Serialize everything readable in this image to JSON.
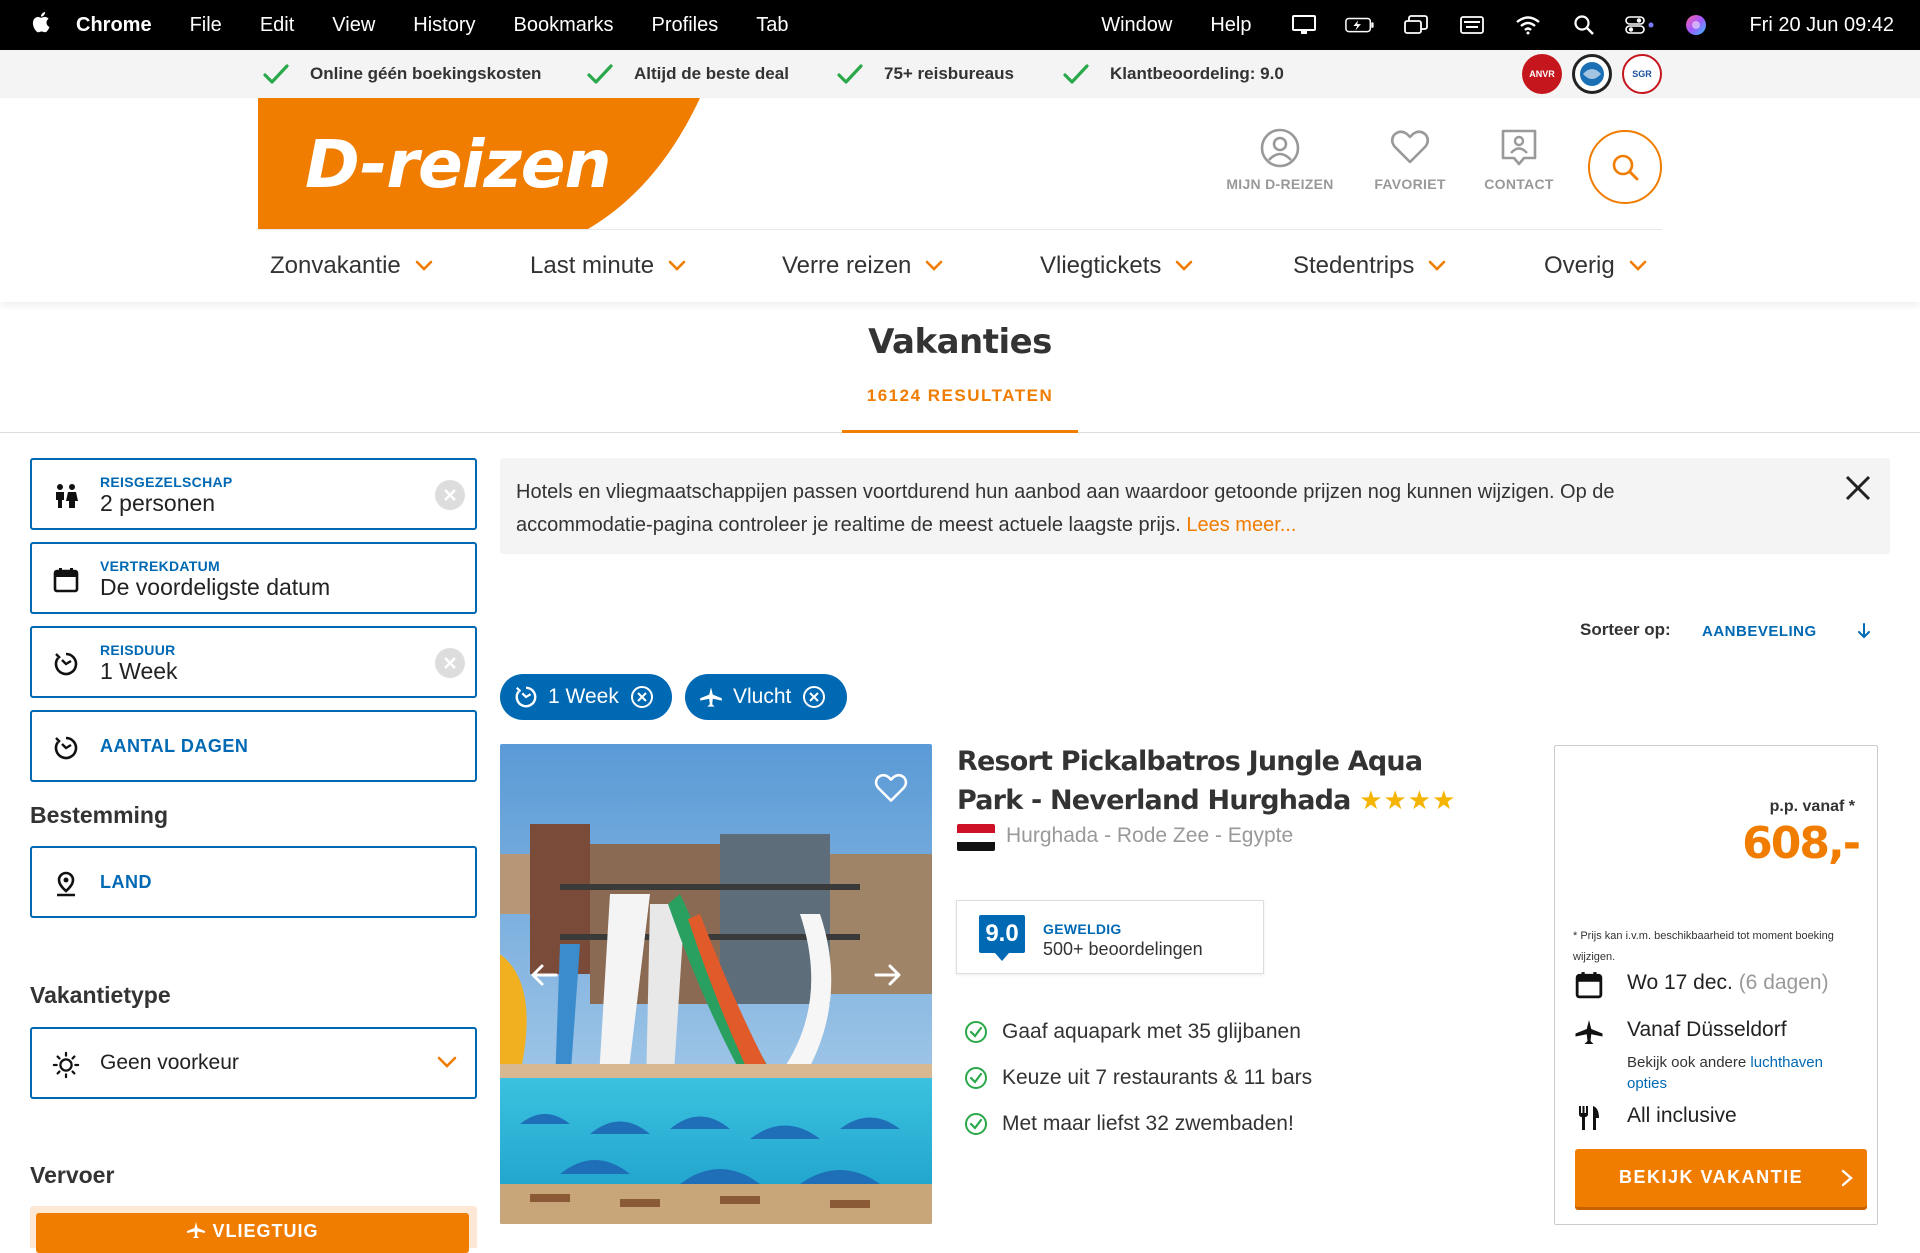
{
  "menubar": {
    "app": "Chrome",
    "items": [
      "File",
      "Edit",
      "View",
      "History",
      "Bookmarks",
      "Profiles",
      "Tab"
    ],
    "right_items": [
      "Window",
      "Help"
    ],
    "clock": "Fri 20 Jun  09:42"
  },
  "usp": [
    "Online géén boekingskosten",
    "Altijd de beste deal",
    "75+ reisbureaus",
    "Klantbeoordeling: 9.0"
  ],
  "badges": [
    "ANVR",
    "Calamiteitenfonds",
    "SGR"
  ],
  "logo": "D-reizen",
  "header_icons": {
    "account": "MIJN D-REIZEN",
    "favorite": "FAVORIET",
    "contact": "CONTACT"
  },
  "nav": [
    "Zonvakantie",
    "Last minute",
    "Verre reizen",
    "Vliegtickets",
    "Stedentrips",
    "Overig"
  ],
  "page": {
    "title": "Vakanties",
    "results": "16124 RESULTATEN"
  },
  "filters": {
    "party": {
      "label": "REISGEZELSCHAP",
      "value": "2 personen"
    },
    "departure": {
      "label": "VERTREKDATUM",
      "value": "De voordeligste datum"
    },
    "duration": {
      "label": "REISDUUR",
      "value": "1 Week"
    },
    "days": {
      "label": "AANTAL DAGEN"
    },
    "destination_heading": "Bestemming",
    "country": {
      "label": "LAND"
    },
    "type_heading": "Vakantietype",
    "type": {
      "value": "Geen voorkeur"
    },
    "transport_heading": "Vervoer",
    "transport_button": "VLIEGTUIG"
  },
  "notice": {
    "text": "Hotels en vliegmaatschappijen passen voortdurend hun aanbod aan waardoor getoonde prijzen nog kunnen wijzigen. Op de accommodatie-pagina controleer je realtime de meest actuele laagste prijs.",
    "link": "Lees meer..."
  },
  "sort": {
    "label": "Sorteer op:",
    "value": "AANBEVELING"
  },
  "chips": [
    {
      "label": "1 Week",
      "icon": "duration-icon"
    },
    {
      "label": "Vlucht",
      "icon": "plane-icon"
    }
  ],
  "result": {
    "name": "Resort Pickalbatros Jungle Aqua Park - Neverland Hurghada",
    "stars": 4,
    "stars_text": "★★★★",
    "location": "Hurghada - Rode Zee - Egypte",
    "rating_score": "9.0",
    "rating_word": "GEWELDIG",
    "rating_count": "500+ beoordelingen",
    "usps": [
      "Gaaf aquapark met 35 glijbanen",
      "Keuze uit 7 restaurants & 11 bars",
      "Met maar liefst 32 zwembaden!"
    ],
    "price_label": "p.p. vanaf *",
    "price": "608,-",
    "price_note": "* Prijs kan i.v.m. beschikbaarheid tot moment boeking wijzigen.",
    "date": "Wo 17 dec.",
    "date_extra": "(6 dagen)",
    "departure": "Vanaf Düsseldorf",
    "departure_sub": "Bekijk ook andere",
    "departure_link": "luchthaven opties",
    "board": "All inclusive",
    "cta": "BEKIJK VAKANTIE"
  },
  "colors": {
    "brand_orange": "#f07c00",
    "brand_blue": "#0069b4",
    "check_green": "#2aa84a"
  }
}
